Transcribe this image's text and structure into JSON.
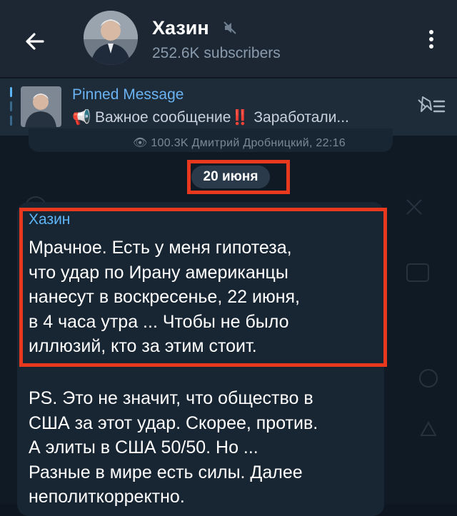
{
  "header": {
    "title": "Хазин",
    "subscribers": "252.6K subscribers"
  },
  "pinned": {
    "title": "Pinned Message",
    "megaphone": "📢",
    "text": "Важное сообщение",
    "excl": "‼️",
    "text_tail": " Заработали..."
  },
  "previous_message": {
    "meta": "👁 100.3K  Дмитрий Дробницкий, 22:16"
  },
  "date_separator": "20 июня",
  "message": {
    "sender": "Хазин",
    "paragraph1": [
      "Мрачное. Есть у меня гипотеза,",
      "что удар по Ирану американцы",
      "нанесут в воскресенье, 22 июня,",
      "в 4 часа утра ... Чтобы не было",
      "иллюзий, кто за этим стоит."
    ],
    "paragraph2": [
      "PS. Это не значит, что общество в",
      "США за этот удар. Скорее, против.",
      "А элиты в США 50/50. Но ...",
      "Разные в мире есть силы. Далее",
      "неполиткорректно."
    ]
  },
  "colors": {
    "accent": "#5eb5f7",
    "highlight": "#e8391f",
    "header_bg": "#1c2733",
    "bubble_bg": "#182533"
  }
}
